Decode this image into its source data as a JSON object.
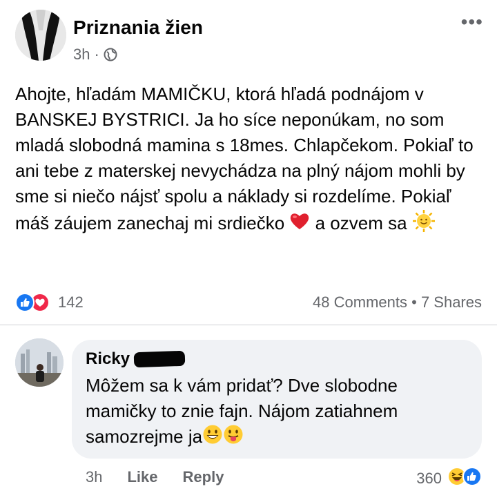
{
  "post": {
    "page_name": "Priznania žien",
    "time": "3h",
    "separator": "·",
    "more": "•••",
    "text": "Ahojte, hľadám MAMIČKU, ktorá hľadá podnájom v BANSKEJ BYSTRICI. Ja ho síce neponúkam, no som mladá slobodná mamina s 18mes. Chlapčekom.  Pokiaľ to ani tebe z materskej nevychádza na plný nájom mohli by sme si niečo nájsť spolu a náklady si rozdelíme. Pokiaľ máš záujem zanechaj mi srdiečko",
    "text_end": " a ozvem sa ",
    "reaction_count": "142",
    "comments": "48 Comments",
    "stats_sep": " • ",
    "shares": "7 Shares"
  },
  "comment": {
    "author": "Ricky",
    "text": "Môžem sa k vám pridať? Dve slobodne mamičky to znie fajn. Nájom zatiahnem samozrejme ja",
    "time": "3h",
    "like_label": "Like",
    "reply_label": "Reply",
    "reaction_count": "360"
  },
  "colors": {
    "like_blue": "#1877f2",
    "love_red": "#f02849",
    "bubble_bg": "#f0f2f5",
    "secondary_text": "#65676b"
  },
  "icons": [
    "globe-icon",
    "more-icon",
    "like-reaction-icon",
    "love-reaction-icon",
    "heart-emoji-icon",
    "sun-emoji-icon",
    "grin-emoji-icon",
    "tongue-emoji-icon",
    "laugh-reaction-icon"
  ]
}
